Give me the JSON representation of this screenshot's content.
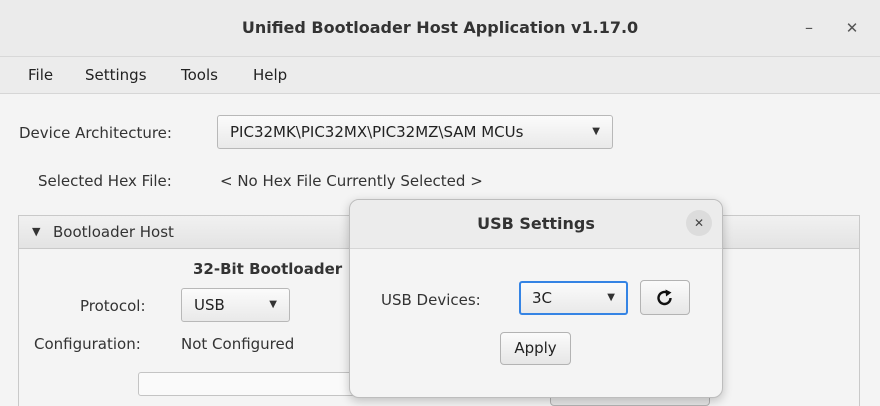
{
  "window": {
    "title": "Unified Bootloader Host Application v1.17.0",
    "minimize_glyph": "–",
    "close_glyph": "✕"
  },
  "menu": [
    {
      "label": "File"
    },
    {
      "label": "Settings"
    },
    {
      "label": "Tools"
    },
    {
      "label": "Help"
    }
  ],
  "form": {
    "device_architecture_label": "Device Architecture:",
    "device_architecture_value": "PIC32MK\\PIC32MX\\PIC32MZ\\SAM MCUs",
    "hex_file_label": "Selected Hex File:",
    "hex_file_value": "< No Hex File Currently Selected >"
  },
  "bootloader_panel": {
    "header": "Bootloader Host",
    "subtitle": "32-Bit Bootloader",
    "protocol_label": "Protocol:",
    "protocol_value": "USB",
    "configuration_label": "Configuration:",
    "configuration_value": "Not Configured"
  },
  "usb_dialog": {
    "title": "USB Settings",
    "devices_label": "USB Devices:",
    "devices_value": "3C",
    "apply_label": "Apply",
    "close_glyph": "✕"
  },
  "icons": {
    "dropdown": "chevron-down-icon",
    "refresh": "refresh-icon",
    "collapse": "triangle-down-icon"
  },
  "colors": {
    "focus_border": "#3584e4",
    "window_bg": "#f4f4f4"
  }
}
